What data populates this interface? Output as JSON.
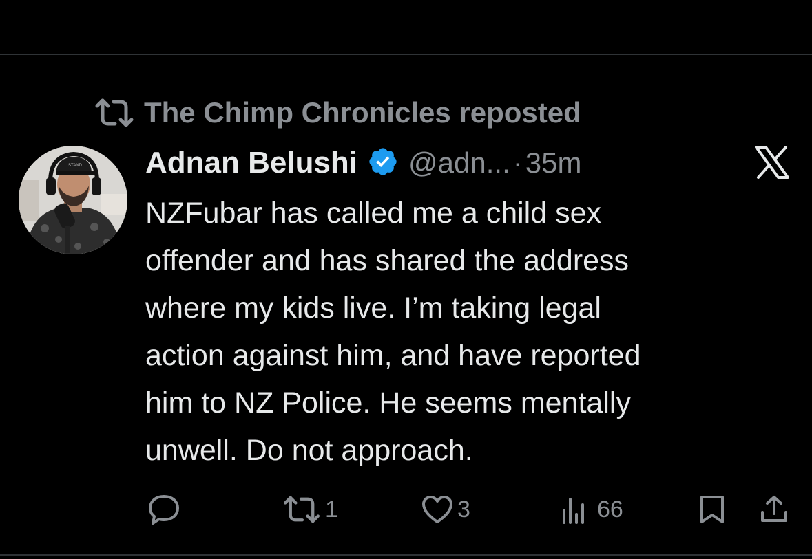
{
  "repost": {
    "icon": "repost-icon",
    "text": "The Chimp Chronicles reposted"
  },
  "tweet": {
    "display_name": "Adnan Belushi",
    "verified_icon": "verified-badge-icon",
    "handle": "@adn...",
    "separator": "·",
    "time": "35m",
    "text": "NZFubar has called me a child sex\noffender and has shared the address\nwhere my kids live. I’m taking legal\naction against him, and have reported\nhim to NZ Police. He seems mentally\nunwell. Do not approach."
  },
  "brand": {
    "logo": "x-logo"
  },
  "actions": {
    "reply": {
      "icon": "reply-icon"
    },
    "repost": {
      "icon": "repost-icon",
      "count": "1"
    },
    "like": {
      "icon": "heart-icon",
      "count": "3"
    },
    "views": {
      "icon": "views-icon",
      "count": "66"
    },
    "bookmark": {
      "icon": "bookmark-icon"
    },
    "share": {
      "icon": "share-icon"
    }
  },
  "colors": {
    "background": "#000000",
    "text_primary": "#e7e9ea",
    "text_secondary": "#8b8f94",
    "verified_blue": "#1d9bf0",
    "divider": "#2f3336"
  }
}
